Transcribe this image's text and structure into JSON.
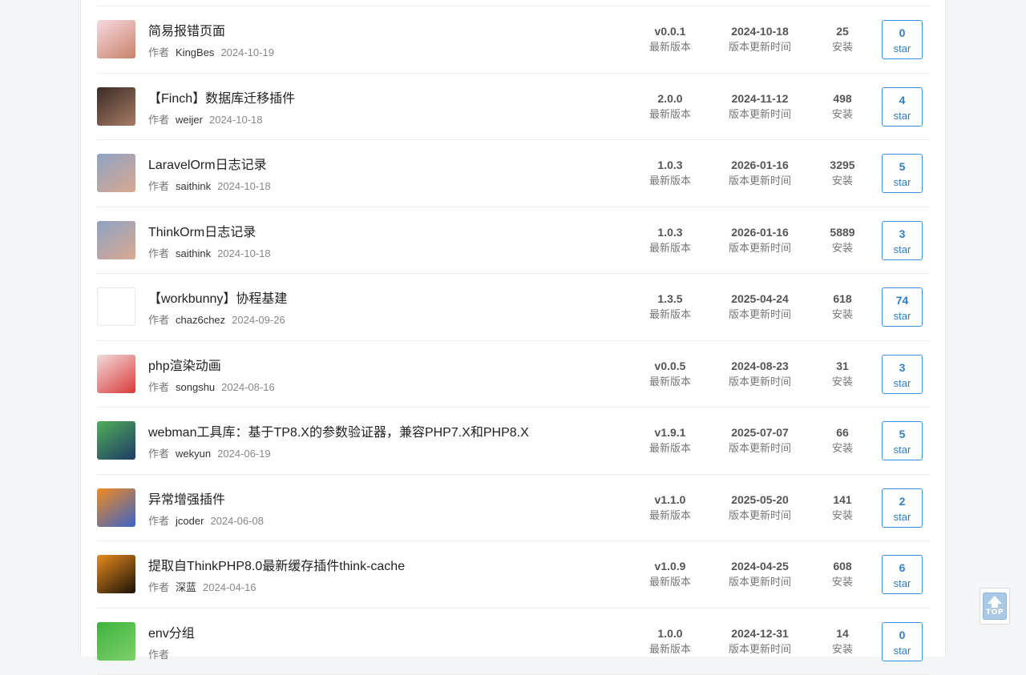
{
  "meta_author_label": "作者",
  "version_label": "最新版本",
  "updated_label": "版本更新时间",
  "installs_label": "安装",
  "star_label": "star",
  "top_button_label": "TOP",
  "plugins": [
    {
      "name": "简易报错页面",
      "author": "KingBes",
      "created": "2024-10-19",
      "version": "v0.0.1",
      "updated": "2024-10-18",
      "installs": "25",
      "stars": "0",
      "avatar_icon": "anime-girl-avatar-icon",
      "avatar_color": "#f7d9df",
      "avatar_color2": "#c9826b"
    },
    {
      "name": "【Finch】数据库迁移插件",
      "author": "weijer",
      "created": "2024-10-18",
      "version": "2.0.0",
      "updated": "2024-11-12",
      "installs": "498",
      "stars": "4",
      "avatar_icon": "dark-portrait-avatar-icon",
      "avatar_color": "#3a2c26",
      "avatar_color2": "#a77b63"
    },
    {
      "name": "LaravelOrm日志记录",
      "author": "saithink",
      "created": "2024-10-18",
      "version": "1.0.3",
      "updated": "2026-01-16",
      "installs": "3295",
      "stars": "5",
      "avatar_icon": "sunset-figure-avatar-icon",
      "avatar_color": "#8ea3c4",
      "avatar_color2": "#d9a890"
    },
    {
      "name": "ThinkOrm日志记录",
      "author": "saithink",
      "created": "2024-10-18",
      "version": "1.0.3",
      "updated": "2026-01-16",
      "installs": "5889",
      "stars": "3",
      "avatar_icon": "sunset-figure-avatar-icon",
      "avatar_color": "#8ea3c4",
      "avatar_color2": "#d9a890"
    },
    {
      "name": "【workbunny】协程基建",
      "author": "chaz6chez",
      "created": "2024-09-26",
      "version": "1.3.5",
      "updated": "2025-04-24",
      "installs": "618",
      "stars": "74",
      "avatar_icon": "bunny-sketch-avatar-icon",
      "avatar_color": "#ffffff",
      "avatar_color2": "#eeeeee"
    },
    {
      "name": "php渲染动画",
      "author": "songshu",
      "created": "2024-08-16",
      "version": "v0.0.5",
      "updated": "2024-08-23",
      "installs": "31",
      "stars": "3",
      "avatar_icon": "hello-kitty-avatar-icon",
      "avatar_color": "#f3dcdc",
      "avatar_color2": "#d93a3a"
    },
    {
      "name": "webman工具库：基于TP8.X的参数验证器，兼容PHP7.X和PHP8.X",
      "author": "wekyun",
      "created": "2024-06-19",
      "version": "v1.9.1",
      "updated": "2025-07-07",
      "installs": "66",
      "stars": "5",
      "avatar_icon": "cartoon-face-avatar-icon",
      "avatar_color": "#4fae59",
      "avatar_color2": "#1f3a66"
    },
    {
      "name": "异常增强插件",
      "author": "jcoder",
      "created": "2024-06-08",
      "version": "v1.1.0",
      "updated": "2025-05-20",
      "installs": "141",
      "stars": "2",
      "avatar_icon": "goku-avatar-icon",
      "avatar_color": "#f08a20",
      "avatar_color2": "#3a64c8"
    },
    {
      "name": "提取自ThinkPHP8.0最新缓存插件think-cache",
      "author": "深蓝",
      "created": "2024-04-16",
      "version": "v1.0.9",
      "updated": "2024-04-25",
      "installs": "608",
      "stars": "6",
      "avatar_icon": "cyclist-sunset-avatar-icon",
      "avatar_color": "#e88a1e",
      "avatar_color2": "#1a1207"
    },
    {
      "name": "env分组",
      "author": "",
      "created": "",
      "version": "1.0.0",
      "updated": "2024-12-31",
      "installs": "14",
      "stars": "0",
      "avatar_icon": "green-leaf-avatar-icon",
      "avatar_color": "#3cb43c",
      "avatar_color2": "#7fd06b"
    }
  ],
  "colors": {
    "accent": "#2d7fd3",
    "border": "#ececec",
    "background": "#f4f5f7"
  }
}
